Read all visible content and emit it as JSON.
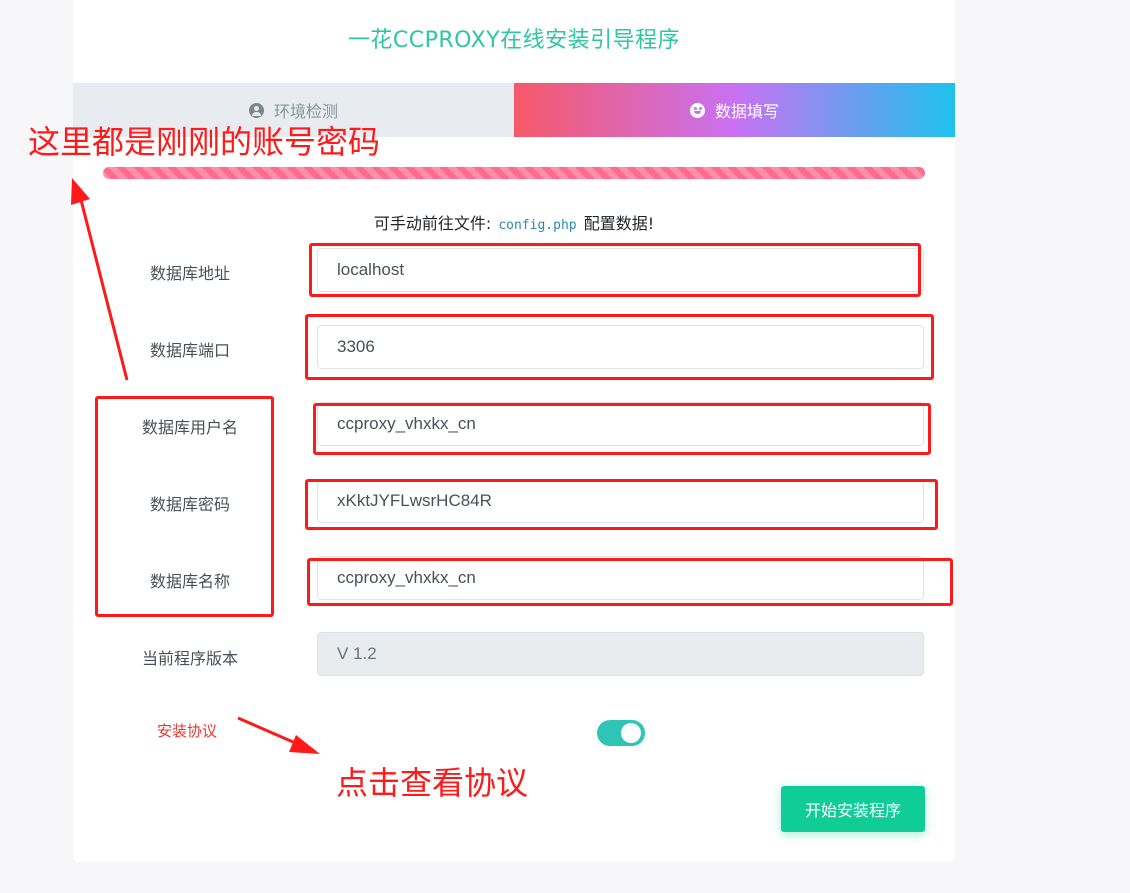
{
  "title": "一花CCPROXY在线安装引导程序",
  "tabs": [
    {
      "label": "环境检测",
      "icon": "user-circle-icon",
      "active": false
    },
    {
      "label": "数据填写",
      "icon": "smile-icon",
      "active": true
    }
  ],
  "progress": 1.0,
  "hint": {
    "prefix": "可手动前往文件:",
    "file": "config.php",
    "suffix": "配置数据!"
  },
  "fields": [
    {
      "label": "数据库地址",
      "value": "localhost"
    },
    {
      "label": "数据库端口",
      "value": "3306"
    },
    {
      "label": "数据库用户名",
      "value": "ccproxy_vhxkx_cn"
    },
    {
      "label": "数据库密码",
      "value": "xKktJYFLwsrHC84R"
    },
    {
      "label": "数据库名称",
      "value": "ccproxy_vhxkx_cn"
    },
    {
      "label": "当前程序版本",
      "value": "V 1.2",
      "readonly": true
    }
  ],
  "agreement": {
    "label": "安装协议",
    "enabled": true
  },
  "submit_label": "开始安装程序",
  "annotations": {
    "top_note": "这里都是刚刚的账号密码",
    "bottom_note": "点击查看协议",
    "color": "#ff1a1a"
  },
  "colors": {
    "accent": "#2dc6a0",
    "button": "#10cc96",
    "toggle": "#2ec4b6",
    "progress": "#ff6b8b"
  }
}
